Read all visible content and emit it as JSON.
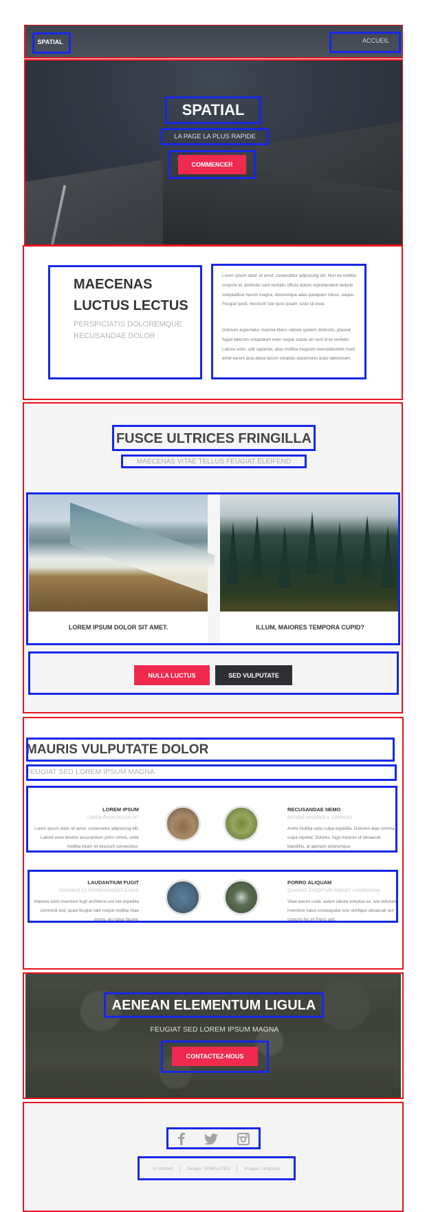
{
  "header": {
    "logo": "SPATIAL",
    "nav": "ACCUEIL"
  },
  "banner": {
    "title": "SPATIAL",
    "subtitle": "LA PAGE LA PLUS RAPIDE",
    "button": "COMMENCER"
  },
  "one": {
    "heading": "MAECENAS LUCTUS LECTUS",
    "subheading": "PERSPICIATIS DOLOREMQUE RECUSANDAE DOLOR",
    "para1": "Lorem ipsum dolor sit amet, consectetur adipisicing elit. Non ea mollitia corporis id, distinctio sunt veritatis officiis dolore reprehenderit deleniti voluptatibus harum magna, doloremque alias quisquam minus, eaque. Feugiat quod, nesciunt! Iste quos ipsam, iusto sit esse.",
    "para2": "Dolorum aspernatur maxime libero ratione quidem distinctio, placeat fugiat laborum voluptatum enim neque soluta vel sunt id ex veritatis. Labore enim, odit sapiente, alias mollitia magnam exercitationem modi amet earum quia atque ipsum voluptas aspernores quas laboriosam."
  },
  "two": {
    "heading": "FUSCE ULTRICES FRINGILLA",
    "subheading": "MAECENAS VITAE TELLUS FEUGIAT ELEIFEND",
    "cards": [
      {
        "caption": "LOREM IPSUM DOLOR SIT AMET."
      },
      {
        "caption": "ILLUM, MAIORES TEMPORA CUPID?"
      }
    ],
    "buttons": {
      "primary": "NULLA LUCTUS",
      "secondary": "SED VULPUTATE"
    }
  },
  "three": {
    "heading": "MAURIS VULPUTATE DOLOR",
    "subheading": "FEUGIAT SED LOREM IPSUM MAGNA",
    "features": [
      {
        "title": "LOREM IPSUM",
        "sub": "LOREM IPSUM DOLOR SIT",
        "text": "Lorem ipsum dolor sit amet, consectetur adipisicing elit. Labore esse tenetur accusantium porro omnis, unde mollitia totam sit nesciunt consectetur."
      },
      {
        "title": "RECUSANDAE NEMO",
        "sub": "RATIONE MAIORES A, COMMODI",
        "text": "Animi mollitia optio culpa expedita. Dolorem alias minima culpa repellat. Dolores, fuga maiores ut obcaecati blanditiis, at aperiam doloremque."
      },
      {
        "title": "LAUDANTIUM FUGIT",
        "sub": "POSSIMUS EX REPREHENDERIT EAQUE",
        "text": "Maiores iusto inventore fugit architecto est iste expedita commodi sed, quasi feugiat nam neque mollitia vitae omnis, eis natus facere."
      },
      {
        "title": "PORRO ALIQUAM",
        "sub": "QUAERAT, EXCEPTURI EVENIET LABORIOSAM",
        "text": "Vitae earum unde, autem labore voluptas ex, iste dolorum inventore natus consequatur iure similique obcaecati aut corporis hic in! Porro sed."
      }
    ]
  },
  "four": {
    "heading": "AENEAN ELEMENTUM LIGULA",
    "subheading": "FEUGIAT SED LOREM IPSUM MAGNA",
    "button": "CONTACTEZ-NOUS"
  },
  "footer": {
    "icons": [
      "facebook-icon",
      "twitter-icon",
      "instagram-icon"
    ],
    "copyright": "© Untitled",
    "design": "Design: TEMPLATED",
    "images": "Images: Unsplash"
  },
  "colors": {
    "accent": "#f0294f",
    "dark_button": "#2e2f33",
    "outline_red": "#e8131b",
    "outline_blue": "#1727e8"
  }
}
